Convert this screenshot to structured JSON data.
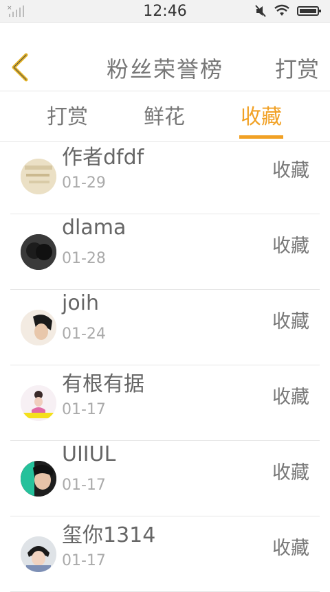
{
  "status_bar": {
    "time": "12:46",
    "icons": [
      "signal-icon",
      "mute-icon",
      "wifi-icon",
      "battery-icon"
    ]
  },
  "header": {
    "title": "粉丝荣誉榜",
    "action_label": "打赏"
  },
  "tabs": [
    {
      "label": "打赏",
      "active": false
    },
    {
      "label": "鲜花",
      "active": false
    },
    {
      "label": "收藏",
      "active": true
    }
  ],
  "accent_color": "#f1a125",
  "list": [
    {
      "name": "作者dfdf",
      "date": "01-29",
      "action": "收藏"
    },
    {
      "name": "dlama",
      "date": "01-28",
      "action": "收藏"
    },
    {
      "name": "joih",
      "date": "01-24",
      "action": "收藏"
    },
    {
      "name": "有根有据",
      "date": "01-17",
      "action": "收藏"
    },
    {
      "name": "UIIUL",
      "date": "01-17",
      "action": "收藏"
    },
    {
      "name": "玺你1314",
      "date": "01-17",
      "action": "收藏"
    }
  ]
}
